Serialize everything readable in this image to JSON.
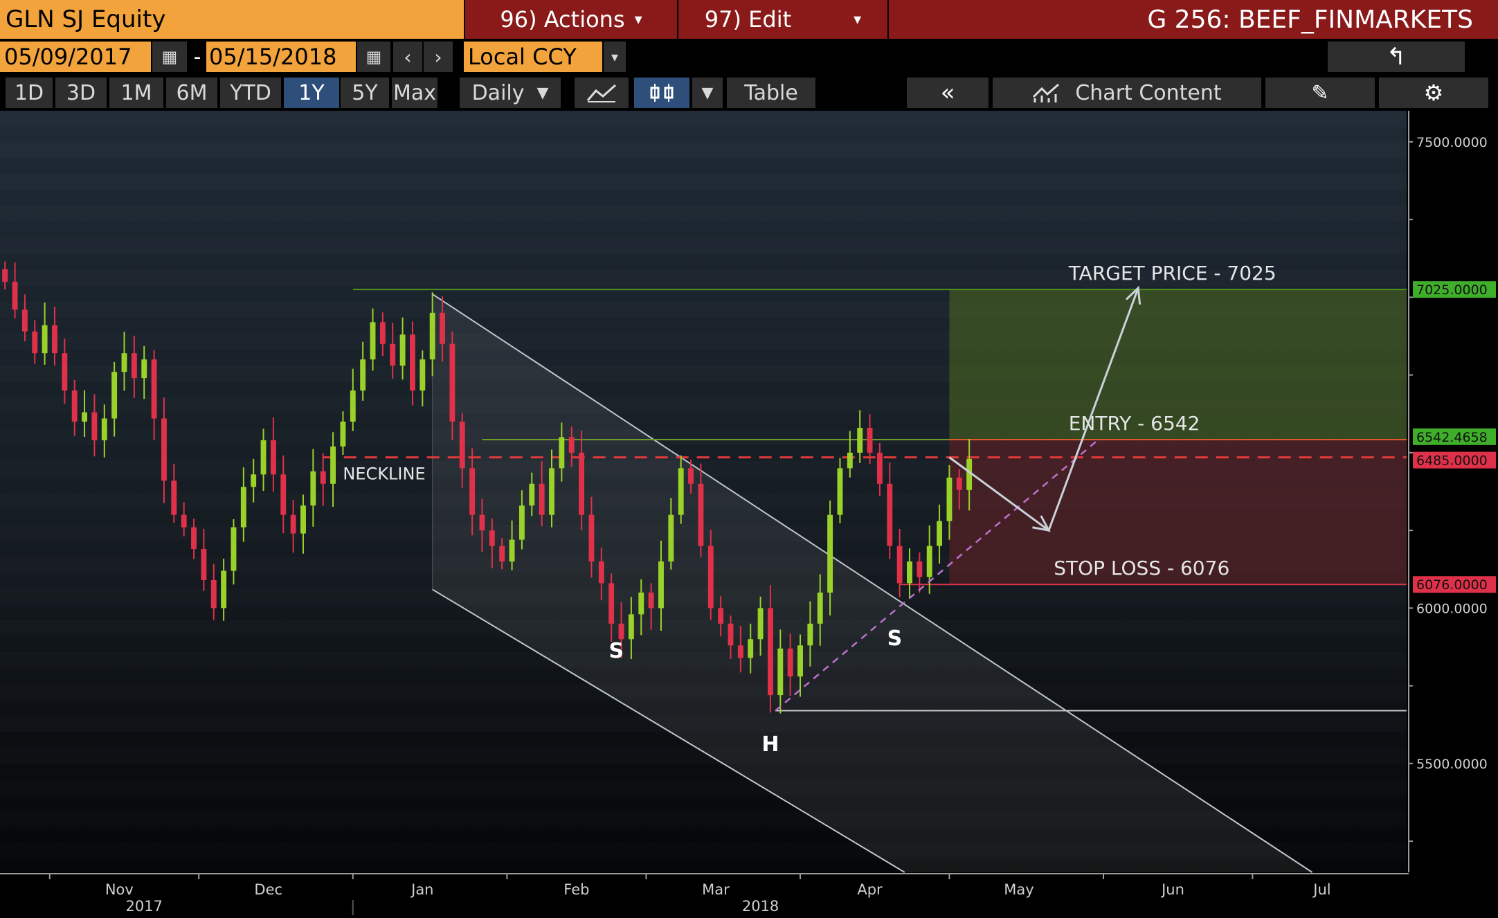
{
  "header": {
    "security": "GLN SJ Equity",
    "actions_label": "96) Actions",
    "edit_label": "97) Edit",
    "graph_title": "G 256: BEEF_FINMARKETS",
    "start_date": "05/09/2017",
    "date_separator": "-",
    "end_date": "05/15/2018",
    "currency": "Local CCY"
  },
  "toolbar": {
    "ranges": [
      "1D",
      "3D",
      "1M",
      "6M",
      "YTD",
      "1Y",
      "5Y",
      "Max"
    ],
    "active_range": "1Y",
    "frequency": "Daily",
    "table_label": "Table",
    "chart_content_label": "Chart Content"
  },
  "colors": {
    "up": "#9ad22a",
    "down": "#e0314a",
    "neckline": "#e03a3a",
    "target_line": "#4f8f1f",
    "entry_line": "#e25a2a",
    "stop_line": "#d8354a",
    "accent_orange": "#f3a33c"
  },
  "chart_data": {
    "type": "candlestick",
    "ylim": [
      5150,
      7600
    ],
    "yticks": [
      {
        "value": 7500,
        "label": "7500.0000"
      },
      {
        "value": 6000,
        "label": "6000.0000"
      },
      {
        "value": 5500,
        "label": "5500.0000"
      }
    ],
    "price_tags": [
      {
        "value": 7025,
        "label": "7025.0000",
        "color": "#3fae2a"
      },
      {
        "value": 6542.4658,
        "label": "6542.4658",
        "color": "#3fae2a"
      },
      {
        "value": 6485,
        "label": "6485.0000",
        "color": "#e0314a"
      },
      {
        "value": 6076,
        "label": "6076.0000",
        "color": "#e0314a"
      }
    ],
    "x_start": "2017-10-22",
    "x_end": "2018-08-01",
    "month_labels": [
      {
        "date": "2017-11-01",
        "label": "Nov"
      },
      {
        "date": "2017-12-01",
        "label": "Dec"
      },
      {
        "date": "2018-01-01",
        "label": "Jan"
      },
      {
        "date": "2018-02-01",
        "label": "Feb"
      },
      {
        "date": "2018-03-01",
        "label": "Mar"
      },
      {
        "date": "2018-04-01",
        "label": "Apr"
      },
      {
        "date": "2018-05-01",
        "label": "May"
      },
      {
        "date": "2018-06-01",
        "label": "Jun"
      },
      {
        "date": "2018-07-01",
        "label": "Jul"
      }
    ],
    "year_labels": [
      {
        "date": "2017-11-20",
        "label": "2017"
      },
      {
        "date": "2018-03-24",
        "label": "2018"
      }
    ],
    "annotations": {
      "target": "TARGET PRICE - 7025",
      "entry": "ENTRY - 6542",
      "stop": "STOP LOSS - 6076",
      "neckline": "NECKLINE",
      "left_shoulder": "S",
      "head": "H",
      "right_shoulder": "S"
    },
    "levels": {
      "target": 7025,
      "entry": 6542,
      "neckline": 6485,
      "stop": 6076,
      "head_low": 5670
    },
    "channel": {
      "upper": [
        [
          "2018-01-17",
          7010
        ],
        [
          "2018-07-13",
          5150
        ]
      ],
      "lower": [
        [
          "2018-01-17",
          6060
        ],
        [
          "2018-04-22",
          5150
        ]
      ]
    },
    "closes": [
      {
        "date": "2017-10-23",
        "close": 7050
      },
      {
        "date": "2017-10-25",
        "close": 6960
      },
      {
        "date": "2017-10-27",
        "close": 6890
      },
      {
        "date": "2017-10-29",
        "close": 6820
      },
      {
        "date": "2017-10-31",
        "close": 6910
      },
      {
        "date": "2017-11-02",
        "close": 6820
      },
      {
        "date": "2017-11-04",
        "close": 6700
      },
      {
        "date": "2017-11-06",
        "close": 6600
      },
      {
        "date": "2017-11-08",
        "close": 6630
      },
      {
        "date": "2017-11-10",
        "close": 6540
      },
      {
        "date": "2017-11-12",
        "close": 6610
      },
      {
        "date": "2017-11-14",
        "close": 6760
      },
      {
        "date": "2017-11-16",
        "close": 6820
      },
      {
        "date": "2017-11-18",
        "close": 6740
      },
      {
        "date": "2017-11-20",
        "close": 6800
      },
      {
        "date": "2017-11-22",
        "close": 6610
      },
      {
        "date": "2017-11-24",
        "close": 6410
      },
      {
        "date": "2017-11-26",
        "close": 6300
      },
      {
        "date": "2017-11-28",
        "close": 6260
      },
      {
        "date": "2017-11-30",
        "close": 6190
      },
      {
        "date": "2017-12-02",
        "close": 6090
      },
      {
        "date": "2017-12-04",
        "close": 6000
      },
      {
        "date": "2017-12-06",
        "close": 6120
      },
      {
        "date": "2017-12-08",
        "close": 6260
      },
      {
        "date": "2017-12-10",
        "close": 6390
      },
      {
        "date": "2017-12-12",
        "close": 6430
      },
      {
        "date": "2017-12-14",
        "close": 6540
      },
      {
        "date": "2017-12-16",
        "close": 6430
      },
      {
        "date": "2017-12-18",
        "close": 6300
      },
      {
        "date": "2017-12-20",
        "close": 6240
      },
      {
        "date": "2017-12-22",
        "close": 6330
      },
      {
        "date": "2017-12-24",
        "close": 6440
      },
      {
        "date": "2017-12-26",
        "close": 6400
      },
      {
        "date": "2017-12-28",
        "close": 6520
      },
      {
        "date": "2017-12-30",
        "close": 6600
      },
      {
        "date": "2018-01-01",
        "close": 6700
      },
      {
        "date": "2018-01-03",
        "close": 6800
      },
      {
        "date": "2018-01-05",
        "close": 6920
      },
      {
        "date": "2018-01-07",
        "close": 6850
      },
      {
        "date": "2018-01-09",
        "close": 6780
      },
      {
        "date": "2018-01-11",
        "close": 6880
      },
      {
        "date": "2018-01-13",
        "close": 6700
      },
      {
        "date": "2018-01-15",
        "close": 6800
      },
      {
        "date": "2018-01-17",
        "close": 6950
      },
      {
        "date": "2018-01-19",
        "close": 6850
      },
      {
        "date": "2018-01-21",
        "close": 6600
      },
      {
        "date": "2018-01-23",
        "close": 6450
      },
      {
        "date": "2018-01-25",
        "close": 6300
      },
      {
        "date": "2018-01-27",
        "close": 6250
      },
      {
        "date": "2018-01-29",
        "close": 6200
      },
      {
        "date": "2018-01-31",
        "close": 6150
      },
      {
        "date": "2018-02-02",
        "close": 6220
      },
      {
        "date": "2018-02-04",
        "close": 6330
      },
      {
        "date": "2018-02-06",
        "close": 6400
      },
      {
        "date": "2018-02-08",
        "close": 6300
      },
      {
        "date": "2018-02-10",
        "close": 6450
      },
      {
        "date": "2018-02-12",
        "close": 6550
      },
      {
        "date": "2018-02-14",
        "close": 6500
      },
      {
        "date": "2018-02-16",
        "close": 6300
      },
      {
        "date": "2018-02-18",
        "close": 6150
      },
      {
        "date": "2018-02-20",
        "close": 6080
      },
      {
        "date": "2018-02-22",
        "close": 5950
      },
      {
        "date": "2018-02-24",
        "close": 5900
      },
      {
        "date": "2018-02-26",
        "close": 5980
      },
      {
        "date": "2018-02-28",
        "close": 6050
      },
      {
        "date": "2018-03-02",
        "close": 6000
      },
      {
        "date": "2018-03-04",
        "close": 6150
      },
      {
        "date": "2018-03-06",
        "close": 6300
      },
      {
        "date": "2018-03-08",
        "close": 6450
      },
      {
        "date": "2018-03-10",
        "close": 6400
      },
      {
        "date": "2018-03-12",
        "close": 6200
      },
      {
        "date": "2018-03-14",
        "close": 6000
      },
      {
        "date": "2018-03-16",
        "close": 5950
      },
      {
        "date": "2018-03-18",
        "close": 5880
      },
      {
        "date": "2018-03-20",
        "close": 5840
      },
      {
        "date": "2018-03-22",
        "close": 5900
      },
      {
        "date": "2018-03-24",
        "close": 6000
      },
      {
        "date": "2018-03-26",
        "close": 5720
      },
      {
        "date": "2018-03-28",
        "close": 5870
      },
      {
        "date": "2018-03-30",
        "close": 5780
      },
      {
        "date": "2018-04-01",
        "close": 5880
      },
      {
        "date": "2018-04-03",
        "close": 5950
      },
      {
        "date": "2018-04-05",
        "close": 6050
      },
      {
        "date": "2018-04-07",
        "close": 6300
      },
      {
        "date": "2018-04-09",
        "close": 6450
      },
      {
        "date": "2018-04-11",
        "close": 6500
      },
      {
        "date": "2018-04-13",
        "close": 6580
      },
      {
        "date": "2018-04-15",
        "close": 6500
      },
      {
        "date": "2018-04-17",
        "close": 6400
      },
      {
        "date": "2018-04-19",
        "close": 6200
      },
      {
        "date": "2018-04-21",
        "close": 6080
      },
      {
        "date": "2018-04-23",
        "close": 6150
      },
      {
        "date": "2018-04-25",
        "close": 6100
      },
      {
        "date": "2018-04-27",
        "close": 6200
      },
      {
        "date": "2018-04-29",
        "close": 6280
      },
      {
        "date": "2018-05-01",
        "close": 6420
      },
      {
        "date": "2018-05-03",
        "close": 6380
      },
      {
        "date": "2018-05-05",
        "close": 6480
      }
    ]
  }
}
